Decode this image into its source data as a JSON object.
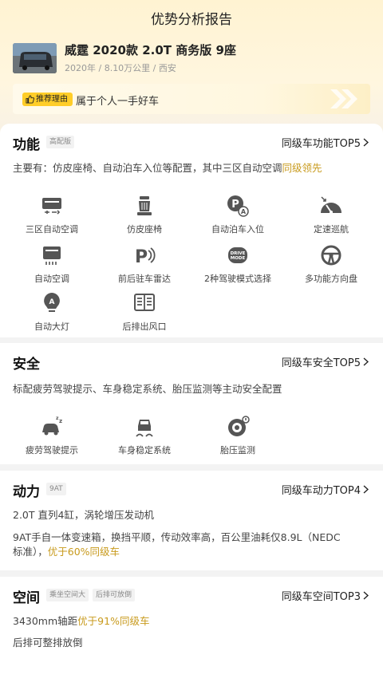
{
  "header": {
    "title": "优势分析报告"
  },
  "car": {
    "name": "威霆 2020款 2.0T 商务版 9座",
    "meta": "2020年 / 8.10万公里 / 西安"
  },
  "recommend": {
    "tag": "推荐理由",
    "text": "属于个人一手好车"
  },
  "function": {
    "title": "功能",
    "tag": "高配版",
    "link": "同级车功能TOP5",
    "desc_prefix": "主要有：仿皮座椅、自动泊车入位等配置，其中三区自动空调",
    "desc_highlight": "同级领先",
    "features": [
      {
        "icon": "tri-zone-ac-icon",
        "label": "三区自动空调"
      },
      {
        "icon": "leather-seat-icon",
        "label": "仿皮座椅"
      },
      {
        "icon": "auto-parking-icon",
        "label": "自动泊车入位"
      },
      {
        "icon": "cruise-control-icon",
        "label": "定速巡航"
      },
      {
        "icon": "auto-ac-icon",
        "label": "自动空调"
      },
      {
        "icon": "parking-radar-icon",
        "label": "前后驻车雷达"
      },
      {
        "icon": "drive-mode-icon",
        "label": "2种驾驶模式选择",
        "icon_text": "DRIVE MODE"
      },
      {
        "icon": "steering-wheel-icon",
        "label": "多功能方向盘"
      },
      {
        "icon": "auto-headlight-icon",
        "label": "自动大灯"
      },
      {
        "icon": "rear-vent-icon",
        "label": "后排出风口"
      }
    ]
  },
  "safety": {
    "title": "安全",
    "link": "同级车安全TOP5",
    "desc": "标配疲劳驾驶提示、车身稳定系统、胎压监测等主动安全配置",
    "features": [
      {
        "icon": "fatigue-warning-icon",
        "label": "疲劳驾驶提示"
      },
      {
        "icon": "stability-control-icon",
        "label": "车身稳定系统"
      },
      {
        "icon": "tire-pressure-icon",
        "label": "胎压监测"
      }
    ]
  },
  "power": {
    "title": "动力",
    "tag": "9AT",
    "link": "同级车动力TOP4",
    "line1": "2.0T 直列4缸，涡轮增压发动机",
    "line2": "9AT手自一体变速箱，换挡平顺，传动效率高，百公里油耗仅8.9L（NEDC",
    "line3_prefix": "标准），",
    "line3_highlight": "优于60%同级车"
  },
  "space": {
    "title": "空间",
    "tags": [
      "乘坐空间大",
      "后排可放倒"
    ],
    "link": "同级车空间TOP3",
    "line1_prefix": "3430mm轴距",
    "line1_highlight": "优于91%同级车",
    "line2": "后排可整排放倒"
  },
  "colors": {
    "accent": "#ffcd28",
    "highlight": "#c89a1c",
    "icon": "#555555"
  }
}
